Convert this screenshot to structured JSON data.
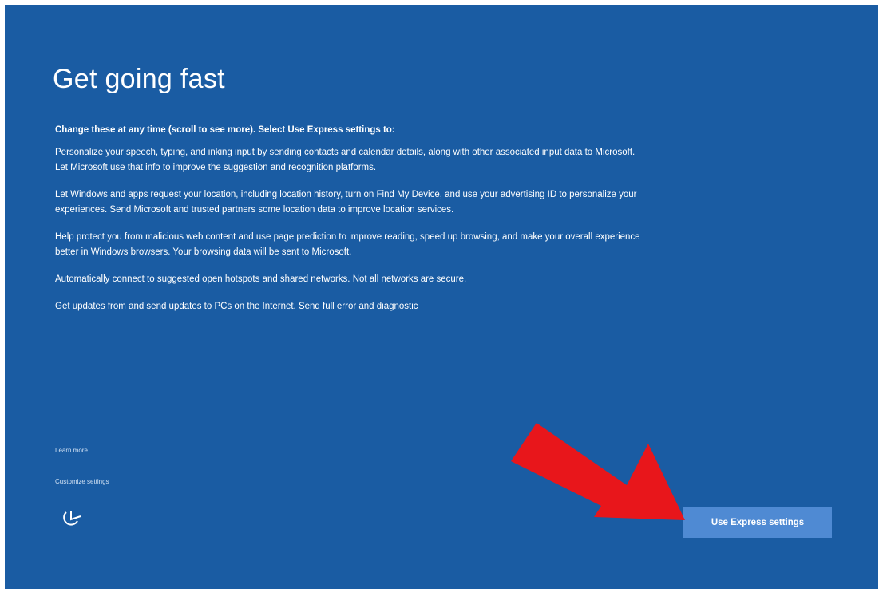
{
  "page": {
    "title": "Get going fast",
    "intro": "Change these at any time (scroll to see more). Select Use Express settings to:",
    "paragraphs": [
      "Personalize your speech, typing, and inking input by sending contacts and calendar details, along with other associated input data to Microsoft. Let Microsoft use that info to improve the suggestion and recognition platforms.",
      "Let Windows and apps request your location, including location history, turn on Find My Device, and use your advertising ID to personalize your experiences. Send Microsoft and trusted partners some location data to improve location services.",
      "Help protect you from malicious web content and use page prediction to improve reading, speed up browsing, and make your overall experience better in Windows browsers. Your browsing data will be sent to Microsoft.",
      "Automatically connect to suggested open hotspots and shared networks. Not all networks are secure.",
      "Get updates from and send updates to PCs on the Internet. Send full error and diagnostic"
    ]
  },
  "links": {
    "learn_more": "Learn more",
    "customize": "Customize settings"
  },
  "buttons": {
    "express": "Use Express settings"
  },
  "icons": {
    "ease_of_access": "ease-of-access-icon",
    "annotation_arrow": "red-arrow"
  },
  "colors": {
    "background": "#1a5ca3",
    "button": "#4f8ad3",
    "arrow": "#e8161b",
    "text": "#ffffff"
  }
}
